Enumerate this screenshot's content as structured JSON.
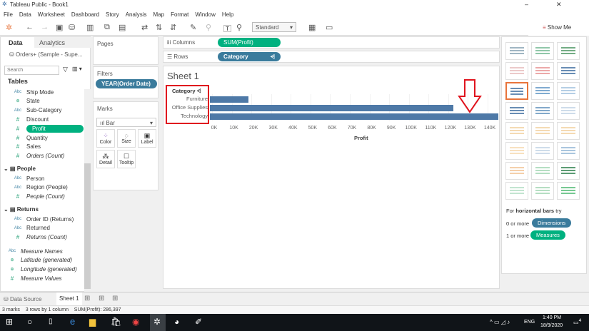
{
  "window": {
    "title": "Tableau Public - Book1"
  },
  "menu": [
    "File",
    "Data",
    "Worksheet",
    "Dashboard",
    "Story",
    "Analysis",
    "Map",
    "Format",
    "Window",
    "Help"
  ],
  "toolbar": {
    "fit_select": "Standard"
  },
  "data_pane": {
    "tab_data": "Data",
    "tab_analytics": "Analytics",
    "datasource": "Orders+ (Sample - Supe...",
    "search_placeholder": "Search",
    "tables_label": "Tables",
    "orders_fields": [
      {
        "icon": "Abc",
        "name": "Ship Mode"
      },
      {
        "icon": "globe",
        "name": "State"
      },
      {
        "icon": "Abc",
        "name": "Sub-Category"
      },
      {
        "icon": "#",
        "name": "Discount"
      },
      {
        "icon": "#",
        "name": "Profit"
      },
      {
        "icon": "#",
        "name": "Quantity"
      },
      {
        "icon": "#",
        "name": "Sales"
      },
      {
        "icon": "#",
        "name": "Orders (Count)"
      }
    ],
    "people_label": "People",
    "people_fields": [
      {
        "icon": "Abc",
        "name": "Person"
      },
      {
        "icon": "Abc",
        "name": "Region (People)"
      },
      {
        "icon": "#",
        "name": "People (Count)"
      }
    ],
    "returns_label": "Returns",
    "returns_fields": [
      {
        "icon": "Abc",
        "name": "Order ID (Returns)"
      },
      {
        "icon": "Abc",
        "name": "Returned"
      },
      {
        "icon": "#",
        "name": "Returns (Count)"
      }
    ],
    "extra_fields": [
      {
        "icon": "Abc",
        "name": "Measure Names"
      },
      {
        "icon": "globe",
        "name": "Latitude (generated)"
      },
      {
        "icon": "globe",
        "name": "Longitude (generated)"
      },
      {
        "icon": "#",
        "name": "Measure Values"
      }
    ]
  },
  "cards": {
    "pages": "Pages",
    "filters": "Filters",
    "filter_pill": "YEAR(Order Date)",
    "marks": "Marks",
    "mark_type": "Bar",
    "mark_buttons": [
      "Color",
      "Size",
      "Label",
      "Detail",
      "Tooltip"
    ]
  },
  "shelves": {
    "columns_label": "Columns",
    "columns_pill": "SUM(Profit)",
    "rows_label": "Rows",
    "rows_pill": "Category"
  },
  "sheet": {
    "title": "Sheet 1",
    "row_header": "Category"
  },
  "chart_data": {
    "type": "bar",
    "orientation": "horizontal",
    "categories": [
      "Furniture",
      "Office Supplies",
      "Technology"
    ],
    "values": [
      18451,
      122491,
      145455
    ],
    "xlabel": "Profit",
    "ylabel": "Category",
    "xlim": [
      0,
      145455
    ],
    "xticks": [
      "0K",
      "10K",
      "20K",
      "30K",
      "40K",
      "50K",
      "60K",
      "70K",
      "80K",
      "90K",
      "100K",
      "110K",
      "120K",
      "130K",
      "140K"
    ],
    "color": "#4e79a7"
  },
  "show_me": {
    "title": "Show Me",
    "hint_prefix": "For",
    "hint_bold": "horizontal bars",
    "hint_suffix": "try",
    "dim_prefix": "0 or more",
    "dim_pill": "Dimensions",
    "meas_prefix": "1 or more",
    "meas_pill": "Measures"
  },
  "tabs": {
    "data_source": "Data Source",
    "sheet1": "Sheet 1"
  },
  "status": {
    "marks": "3 marks",
    "rows": "3 rows by 1 column",
    "sum": "SUM(Profit): 286,397"
  },
  "taskbar": {
    "time": "1:40 PM",
    "date": "18/9/2020",
    "lang": "ENG",
    "notif": "4"
  }
}
